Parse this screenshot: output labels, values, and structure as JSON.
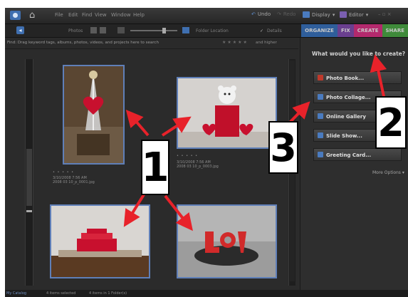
{
  "menu": {
    "items": [
      "File",
      "Edit",
      "Find",
      "View",
      "Window",
      "Help"
    ],
    "undo": "Undo",
    "redo": "Redo",
    "display": "Display",
    "editor": "Editor"
  },
  "toolbar": {
    "photos": "Photos",
    "folder_location": "Folder Location",
    "details": "Details"
  },
  "tabs": [
    {
      "label": "ORGANIZE",
      "color": "#2f5e9b"
    },
    {
      "label": "FIX",
      "color": "#6a3f8f"
    },
    {
      "label": "CREATE",
      "color": "#b3296d"
    },
    {
      "label": "SHARE",
      "color": "#3f8a3a"
    }
  ],
  "infobar": {
    "hint": "Find: Drag keyword tags, albums, photos, videos, and projects here to search",
    "rating": "and higher"
  },
  "photos": [
    {
      "date": "3/10/2008 7:56 AM",
      "file": "2008 03 10_p_0001.jpg",
      "stars": "• • • • •"
    },
    {
      "date": "3/10/2008 7:56 AM",
      "file": "2008 03 10_p_0003.jpg",
      "stars": "• • • • •"
    }
  ],
  "panel": {
    "question": "What would you like to create?",
    "buttons": [
      {
        "label": "Photo Book...",
        "icon": "photo-book-icon",
        "color": "#c0392b"
      },
      {
        "label": "Photo Collage...",
        "icon": "photo-collage-icon",
        "color": "#4a7bbf"
      },
      {
        "label": "Online Gallery",
        "icon": "online-gallery-icon",
        "color": "#4a7bbf"
      },
      {
        "label": "Slide Show...",
        "icon": "slide-show-icon",
        "color": "#4a7bbf"
      },
      {
        "label": "Greeting Card...",
        "icon": "greeting-card-icon",
        "color": "#4a7bbf"
      }
    ],
    "more_options": "More Options"
  },
  "status": {
    "catalog": "My Catalog",
    "selected": "4 items selected",
    "info": "4 items in 1 Folder(s)"
  },
  "callouts": {
    "one": "1",
    "two": "2",
    "three": "3"
  },
  "colors": {
    "arrow": "#e8222a",
    "photo_border": "#5f7fb8",
    "create_tab": "#b3296d"
  }
}
